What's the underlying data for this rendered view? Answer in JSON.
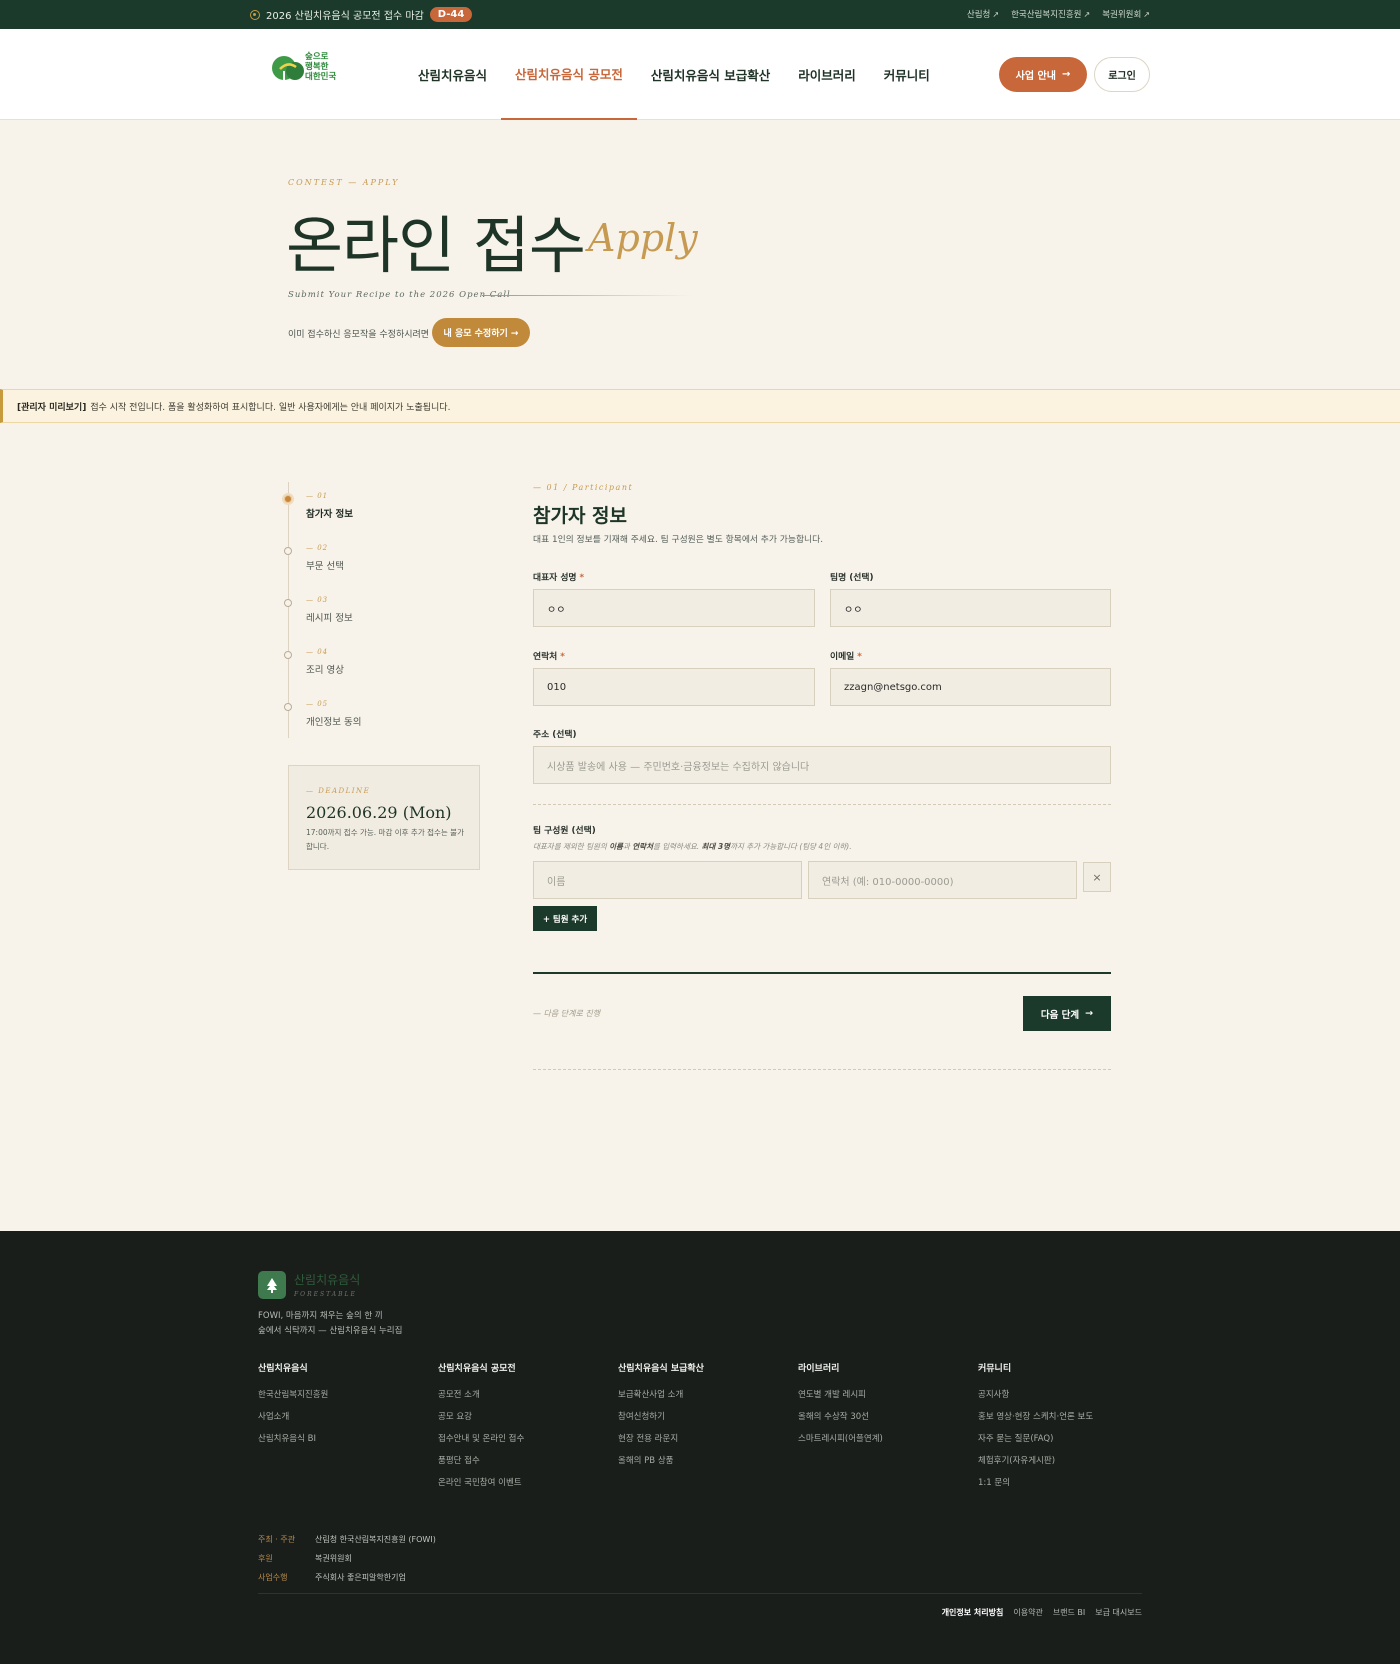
{
  "topbar": {
    "notice": "2026 산림치유음식 공모전 접수 마감",
    "dday": "D-44",
    "links": [
      "산림청",
      "한국산림복지진흥원",
      "복권위원회"
    ]
  },
  "header": {
    "logo_text": "숲으로\n행복한\n대한민국",
    "nav": [
      "산림치유음식",
      "산림치유음식 공모전",
      "산림치유음식 보급확산",
      "라이브러리",
      "커뮤니티"
    ],
    "biz_button": "사업 안내",
    "login_button": "로그인"
  },
  "hero": {
    "eyebrow": "CONTEST  —  APPLY",
    "title": "온라인 접수",
    "title_italic": "Apply",
    "subtitle": "Submit Your Recipe to the 2026 Open Call",
    "edit_text": "이미 접수하신 응모작을 수정하시려면",
    "edit_button": "내 응모 수정하기 →"
  },
  "admin_notice": {
    "tag": "[관리자 미리보기]",
    "text": "접수 시작 전입니다. 폼을 활성화하여 표시합니다. 일반 사용자에게는 안내 페이지가 노출됩니다."
  },
  "steps": [
    {
      "num": "— 01",
      "label": "참가자 정보"
    },
    {
      "num": "— 02",
      "label": "부문 선택"
    },
    {
      "num": "— 03",
      "label": "레시피 정보"
    },
    {
      "num": "— 04",
      "label": "조리 영상"
    },
    {
      "num": "— 05",
      "label": "개인정보 동의"
    }
  ],
  "deadline": {
    "label": "— DEADLINE",
    "date": "2026.06.29 (Mon)",
    "note": "17:00까지 접수 가능. 마감 이후 추가 접수는 불가합니다."
  },
  "form": {
    "eyebrow": "— 01 / Participant",
    "title": "참가자 정보",
    "desc": "대표 1인의 정보를 기재해 주세요. 팀 구성원은 별도 항목에서 추가 가능합니다.",
    "name_label": "대표자 성명",
    "name_value": "ㅇㅇ",
    "team_label": "팀명 (선택)",
    "team_value": "ㅇㅇ",
    "phone_label": "연락처",
    "phone_value": "010",
    "email_label": "이메일",
    "email_value": "zzagn@netsgo.com",
    "address_label": "주소 (선택)",
    "address_placeholder": "시상품 발송에 사용 — 주민번호·금융정보는 수집하지 않습니다",
    "members_label": "팀 구성원 (선택)",
    "members_hint_pre": "대표자를 제외한 팀원의 ",
    "members_hint_b1": "이름",
    "members_hint_mid1": "과 ",
    "members_hint_b2": "연락처",
    "members_hint_mid2": "를 입력하세요. ",
    "members_hint_b3": "최대 3명",
    "members_hint_post": "까지 추가 가능합니다 (팀당 4인 이하).",
    "member_name_placeholder": "이름",
    "member_phone_placeholder": "연락처 (예: 010-0000-0000)",
    "remove_button": "×",
    "add_button": "+ 팀원 추가",
    "next_hint": "— 다음 단계로 진행",
    "next_button": "다음 단계"
  },
  "footer": {
    "brand": "산림치유음식",
    "brand_sub": "FORESTABLE",
    "tagline_1": "FOWI, 마음까지 채우는 숲의 한 끼",
    "tagline_2": "숲에서 식탁까지 — 산림치유음식 누리집",
    "columns": [
      {
        "title": "산림치유음식",
        "items": [
          "한국산림복지진흥원",
          "사업소개",
          "산림치유음식 BI"
        ]
      },
      {
        "title": "산림치유음식 공모전",
        "items": [
          "공모전 소개",
          "공모 요강",
          "접수안내 및 온라인 접수",
          "품평단 접수",
          "온라인 국민참여 이벤트"
        ]
      },
      {
        "title": "산림치유음식 보급확산",
        "items": [
          "보급확산사업 소개",
          "참여신청하기",
          "현장 전용 라운지",
          "올해의 PB 상품"
        ]
      },
      {
        "title": "라이브러리",
        "items": [
          "연도별 개발 레시피",
          "올해의 수상작 30선",
          "스마트레시피(어플연계)"
        ]
      },
      {
        "title": "커뮤니티",
        "items": [
          "공지사항",
          "홍보 영상·현장 스케치·언론 보도",
          "자주 묻는 질문(FAQ)",
          "체험후기(자유게시판)",
          "1:1 문의"
        ]
      }
    ],
    "orgs": [
      {
        "key": "주최 · 주관",
        "value": "산림청    한국산림복지진흥원 (FOWI)"
      },
      {
        "key": "후원",
        "value": "복권위원회"
      },
      {
        "key": "사업수행",
        "value": "주식회사 좋은피알학한기업"
      }
    ],
    "legal": [
      "개인정보 처리방침",
      "이용약관",
      "브랜드 BI",
      "보급 대시보드"
    ]
  },
  "colors": {
    "forest": "#1c3a2b",
    "accent": "#c8673a",
    "gold": "#c79a52",
    "cream": "#f7f3ea"
  }
}
